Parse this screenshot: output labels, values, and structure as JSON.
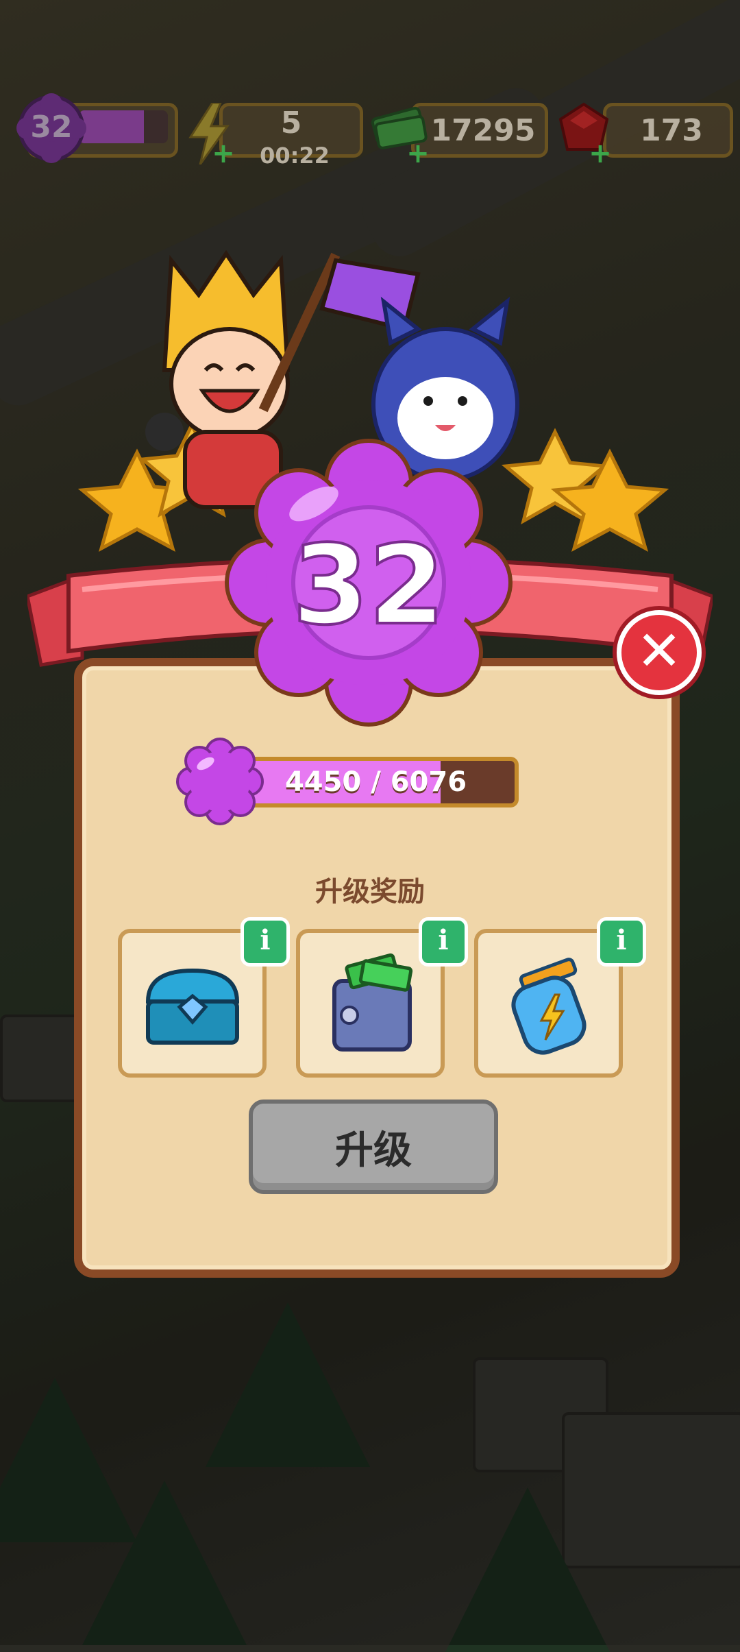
{
  "hud": {
    "level": "32",
    "level_progress_fraction": 0.73,
    "energy": "5",
    "energy_timer": "00:22",
    "cash": "17295",
    "gems": "173"
  },
  "level_up": {
    "level": "32",
    "xp_text": "4450 / 6076",
    "xp_current": 4450,
    "xp_max": 6076,
    "rewards_title": "升级奖励",
    "rewards": [
      {
        "icon": "treasure-chest-icon"
      },
      {
        "icon": "cash-safe-icon"
      },
      {
        "icon": "energy-jar-icon"
      }
    ],
    "upgrade_label": "升级"
  },
  "colors": {
    "accent_purple": "#c447e6",
    "ribbon_red": "#f0545e",
    "panel": "#f0d6a9",
    "info_green": "#2fb36b"
  }
}
